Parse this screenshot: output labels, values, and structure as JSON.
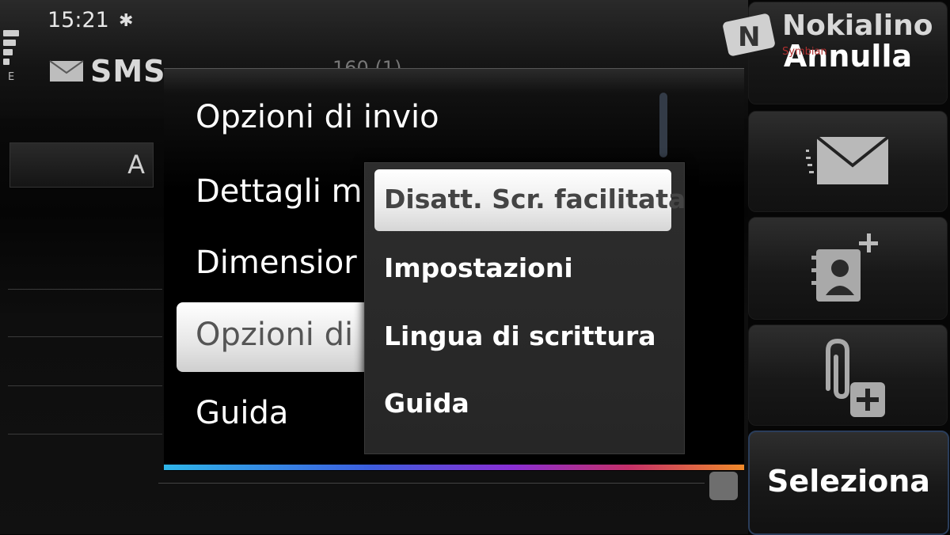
{
  "status": {
    "time": "15:21",
    "network_type": "E",
    "bluetooth_icon": "bluetooth-icon"
  },
  "editor": {
    "title": "SMS",
    "to_label": "A",
    "counter": "160 (1)"
  },
  "menu": {
    "items": [
      {
        "label": "Opzioni di invio"
      },
      {
        "label": "Dettagli m"
      },
      {
        "label": "Dimensior"
      },
      {
        "label": "Opzioni di"
      },
      {
        "label": "Guida"
      }
    ],
    "selected_index": 3
  },
  "submenu": {
    "items": [
      {
        "label": "Disatt. Scr. facilitata"
      },
      {
        "label": "Impostazioni"
      },
      {
        "label": "Lingua di scrittura"
      },
      {
        "label": "Guida"
      }
    ],
    "selected_index": 0
  },
  "toolbar": {
    "cancel_label": "Annulla",
    "select_label": "Seleziona",
    "icons": [
      "send-message-icon",
      "add-contact-icon",
      "attach-icon"
    ]
  },
  "watermark": {
    "text": "Nokialino",
    "sub": "Symbian"
  },
  "colors": {
    "accent_gradient": [
      "#2fb5e8",
      "#3c60e0",
      "#8a2fd6",
      "#c6306a",
      "#f08a2a"
    ],
    "selected_bg": "#ffffff"
  }
}
